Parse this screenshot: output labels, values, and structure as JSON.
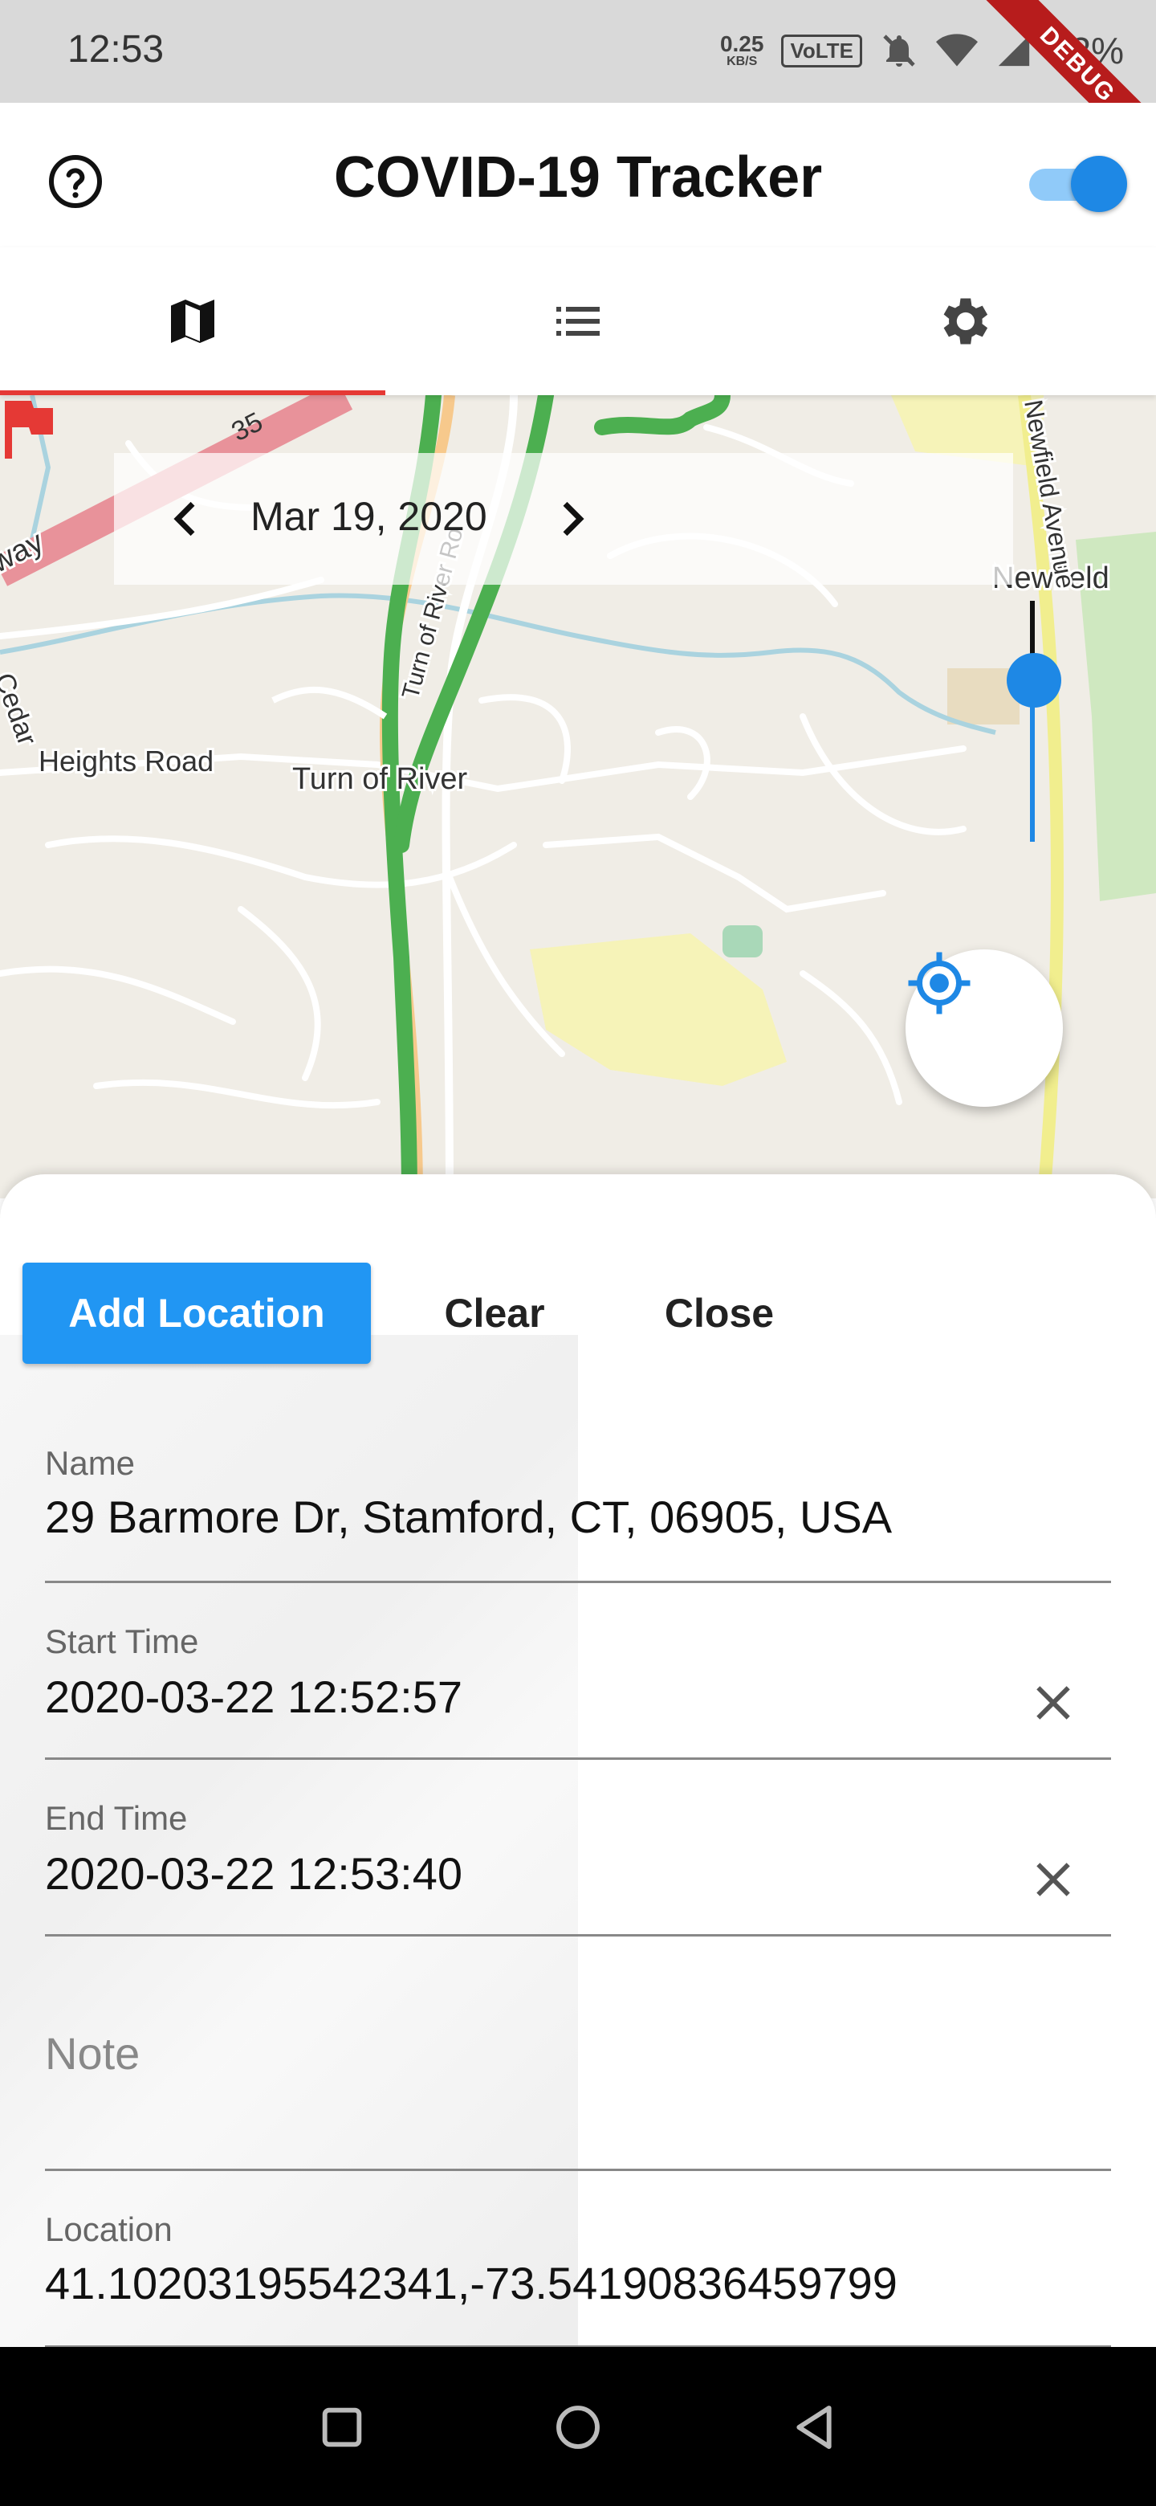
{
  "status_bar": {
    "time": "12:53",
    "net_speed_value": "0.25",
    "net_speed_unit": "KB/S",
    "volte": "VoLTE",
    "battery": "72%",
    "debug_banner": "DEBUG"
  },
  "app_bar": {
    "title": "COVID-19 Tracker",
    "toggle_on": true,
    "help_icon": "help-circle-icon"
  },
  "tabs": [
    {
      "icon": "map-icon",
      "selected": true
    },
    {
      "icon": "list-icon",
      "selected": false
    },
    {
      "icon": "gear-icon",
      "selected": false
    }
  ],
  "colors": {
    "accent": "#2196f3",
    "tab_indicator": "#e53935",
    "flag": "#e53935",
    "track_line": "#4caf50"
  },
  "map": {
    "date": "Mar 19, 2020",
    "labels": {
      "parkway": "Merritt Parkway",
      "route": "35",
      "heights_road": "Heights Road",
      "cedar": "Cedar",
      "turn_of_river": "Turn of River",
      "turn_of_river_road": "Turn of River Ro",
      "newfield": "Newfield",
      "newfield_avenue": "Newfield Avenue"
    },
    "zoom_level_fraction": 0.33
  },
  "sheet": {
    "add_label": "Add Location",
    "clear_label": "Clear",
    "close_label": "Close",
    "name_label": "Name",
    "name_value": "29 Barmore Dr, Stamford, CT, 06905, USA",
    "start_label": "Start Time",
    "start_value": "2020-03-22 12:52:57",
    "end_label": "End Time",
    "end_value": "2020-03-22 12:53:40",
    "note_placeholder": "Note",
    "location_label": "Location",
    "location_value": "41.10203195542341,-73.54190836459799"
  }
}
